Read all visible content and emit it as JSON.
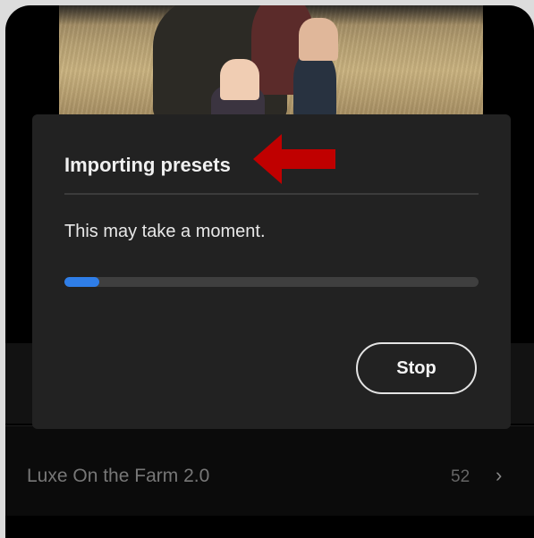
{
  "dialog": {
    "title": "Importing presets",
    "message": "This may take a moment.",
    "progress_fraction": 0.085,
    "stop_label": "Stop"
  },
  "list": {
    "item_name": "Luxe On the Farm 2.0",
    "item_count": "52",
    "chevron_icon": "chevron-right-icon"
  },
  "colors": {
    "progress_fill": "#2f7ee8",
    "arrow": "#c00000"
  }
}
